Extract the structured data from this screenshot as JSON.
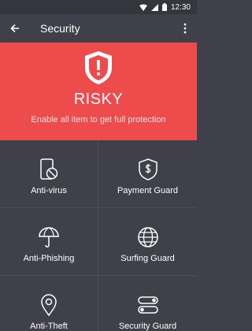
{
  "status_bar": {
    "time": "12:30"
  },
  "app_bar": {
    "title": "Security"
  },
  "hero": {
    "status": "RISKY",
    "message": "Enable all item to get full protection",
    "color": "#ee4b4d"
  },
  "tiles": [
    {
      "label": "Anti-virus",
      "icon": "phone-shield-icon"
    },
    {
      "label": "Payment Guard",
      "icon": "dollar-shield-icon"
    },
    {
      "label": "Anti-Phishing",
      "icon": "umbrella-icon"
    },
    {
      "label": "Surfing Guard",
      "icon": "globe-icon"
    },
    {
      "label": "Anti-Theft",
      "icon": "location-pin-icon"
    },
    {
      "label": "Security Guard",
      "icon": "toggle-switches-icon"
    }
  ]
}
